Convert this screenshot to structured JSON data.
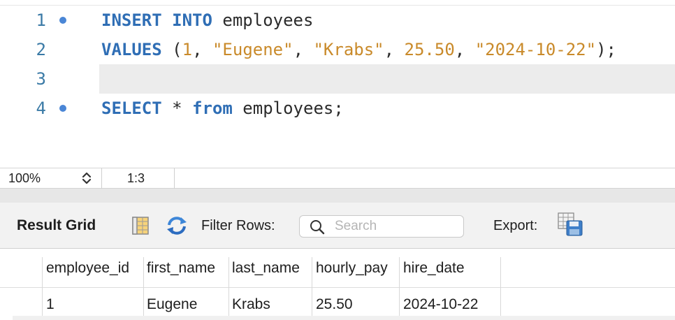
{
  "editor": {
    "lines": [
      {
        "number": "1",
        "marker": true
      },
      {
        "number": "2",
        "marker": false
      },
      {
        "number": "3",
        "marker": false
      },
      {
        "number": "4",
        "marker": true
      }
    ],
    "line1": {
      "kw1": "INSERT",
      "kw2": "INTO",
      "rest": " employees"
    },
    "line2": {
      "kw": "VALUES",
      "p1": " (",
      "n1": "1",
      "c1": ", ",
      "s1": "\"Eugene\"",
      "c2": ", ",
      "s2": "\"Krabs\"",
      "c3": ", ",
      "n2": "25.50",
      "c4": ", ",
      "s3": "\"2024-10-22\"",
      "end": ");"
    },
    "line4": {
      "kw1": "SELECT",
      "star": " * ",
      "kw2": "from",
      "rest": " employees;"
    }
  },
  "statusbar": {
    "zoom": "100%",
    "cursor": "1:3"
  },
  "toolbar": {
    "result_grid": "Result Grid",
    "filter_rows": "Filter Rows:",
    "search_placeholder": "Search",
    "export": "Export:",
    "icons": [
      "grid-view-icon",
      "refresh-icon",
      "search-icon",
      "export-icon"
    ]
  },
  "grid": {
    "columns": [
      "employee_id",
      "first_name",
      "last_name",
      "hourly_pay",
      "hire_date"
    ],
    "rows": [
      [
        "1",
        "Eugene",
        "Krabs",
        "25.50",
        "2024-10-22"
      ]
    ]
  }
}
